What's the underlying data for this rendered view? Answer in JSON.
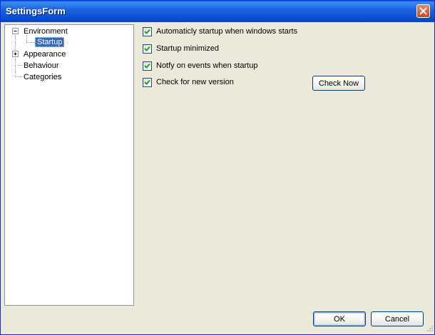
{
  "window": {
    "title": "SettingsForm",
    "close_icon": "close-icon"
  },
  "tree": {
    "items": [
      {
        "label": "Environment",
        "expander": "minus-icon"
      },
      {
        "label": "Startup",
        "selected": true
      },
      {
        "label": "Appearance",
        "expander": "plus-icon"
      },
      {
        "label": "Behaviour"
      },
      {
        "label": "Categories"
      }
    ]
  },
  "options": [
    {
      "label": "Automaticly startup when windows starts",
      "checked": true
    },
    {
      "label": "Startup minimized",
      "checked": true
    },
    {
      "label": "Notfy on events when startup",
      "checked": true
    },
    {
      "label": "Check for new version",
      "checked": true
    }
  ],
  "buttons": {
    "check_now": "Check Now",
    "ok": "OK",
    "cancel": "Cancel"
  },
  "colors": {
    "titlebar": "#0a5fd8",
    "selection": "#316ac5",
    "check": "#21a121",
    "face": "#ece9d8"
  }
}
